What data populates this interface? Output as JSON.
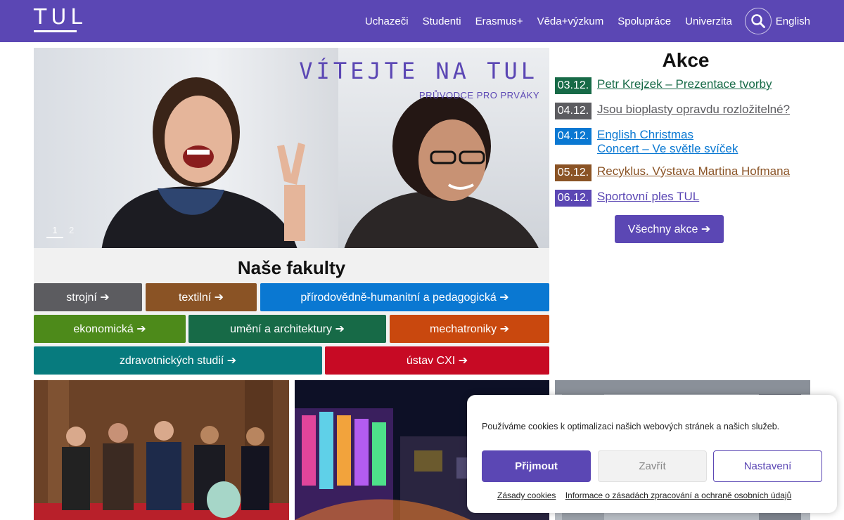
{
  "header": {
    "logo_text": "TUL",
    "nav": [
      "Uchazeči",
      "Studenti",
      "Erasmus+",
      "Věda+výzkum",
      "Spolupráce",
      "Univerzita"
    ],
    "search_icon": "search-icon",
    "language": "English"
  },
  "hero": {
    "headline": "VÍTEJTE NA TUL",
    "subline": "PRŮVODCE PRO PRVÁKY",
    "slides": [
      "1",
      "2"
    ]
  },
  "faculties": {
    "title": "Naše fakulty",
    "items": [
      {
        "label": "strojní ➔",
        "color": "#5c5c60"
      },
      {
        "label": "textilní ➔",
        "color": "#8a5325"
      },
      {
        "label": "přírodovědně-humanitní a pedagogická ➔",
        "color": "#0a78d2"
      },
      {
        "label": "ekonomická ➔",
        "color": "#4d8a1a"
      },
      {
        "label": "umění a architektury ➔",
        "color": "#176a47"
      },
      {
        "label": "mechatroniky ➔",
        "color": "#c9480e"
      },
      {
        "label": "zdravotnických studií ➔",
        "color": "#077b7e"
      },
      {
        "label": "ústav CXI ➔",
        "color": "#c70a24"
      }
    ]
  },
  "events": {
    "title": "Akce",
    "items": [
      {
        "date": "03.12.",
        "title": "Petr Krejzek – Prezentace tvorby",
        "color": "#176a47"
      },
      {
        "date": "04.12.",
        "title": "Jsou bioplasty opravdu rozložitelné?",
        "color": "#5c5c60"
      },
      {
        "date": "04.12.",
        "title": "English Christmas",
        "title2": "Concert – Ve světle svíček",
        "color": "#0a78d2"
      },
      {
        "date": "05.12.",
        "title": "Recyklus. Výstava Martina Hofmana",
        "color": "#8a5325"
      },
      {
        "date": "06.12.",
        "title": "Sportovní ples TUL",
        "color": "#5b47b4"
      }
    ],
    "all_button": "Všechny akce ➔"
  },
  "cookie": {
    "message": "Používáme cookies k optimalizaci našich webových stránek a našich služeb.",
    "accept": "Přijmout",
    "close": "Zavřít",
    "settings": "Nastavení",
    "link_cookies": "Zásady cookies",
    "link_privacy": "Informace o zásadách zpracování a ochraně osobních údajů"
  }
}
